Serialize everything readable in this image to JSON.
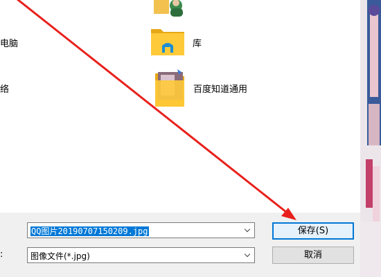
{
  "nav": {
    "computer_label": "电脑",
    "network_label": "络"
  },
  "items": [
    {
      "label": "库",
      "icon": "library-folder-icon"
    },
    {
      "label": "百度知道通用",
      "icon": "baidu-folder-icon"
    }
  ],
  "filename": {
    "value": "QQ图片20190707150209.jpg"
  },
  "filetype": {
    "label": ":",
    "value": "图像文件(*.jpg)"
  },
  "buttons": {
    "save": "保存(S)",
    "cancel": "取消"
  },
  "colors": {
    "arrow": "#e8201c",
    "selection": "#0078d7",
    "folder": "#ffca3a",
    "panel": "#f0f0f0"
  }
}
